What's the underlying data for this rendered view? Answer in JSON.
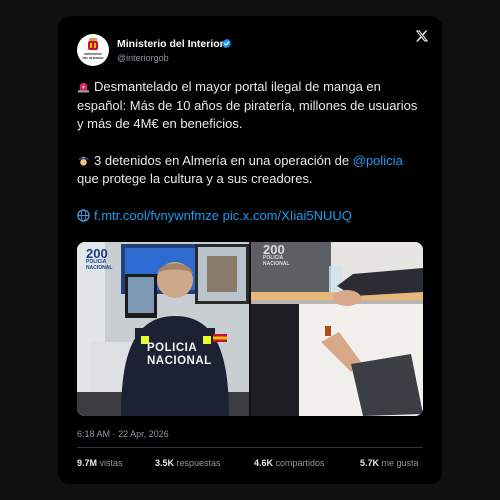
{
  "account": {
    "name": "Ministerio del Interior",
    "handle": "@interiorgob",
    "avatar_text": "MINISTERIO\nDEL INTERIOR",
    "verified_color": "#1d9bf0"
  },
  "tweet": {
    "line1_emoji": "siren-icon",
    "line1": "Desmantelado el mayor portal ilegal de manga en español: Más de 10 años de piratería, millones de usuarios y más de 4M€ en beneficios.",
    "line2_emoji": "police-officer-icon",
    "line2_before": "3 detenidos en Almería en una operación de ",
    "line2_mention": "@policia",
    "line2_after": " que protege la cultura y a sus creadores.",
    "link_emoji": "globe-icon",
    "link1": "f.mtr.cool/fvnywnfmze",
    "link2": "pic.x.com/XIiai5NUUQ"
  },
  "media": {
    "left_logo_number": "200",
    "left_logo_text": "POLICIA\nNACIONAL",
    "left_vest_text": "POLICIA\nNACIONAL",
    "right_logo_number": "200",
    "right_logo_text": "POLICIA\nNACIONAL"
  },
  "meta": {
    "time": "6:18 AM",
    "separator": "·",
    "date": "22 Apr, 2026"
  },
  "stats": [
    {
      "value": "9.7M",
      "label": "vistas"
    },
    {
      "value": "3.5K",
      "label": "respuestas"
    },
    {
      "value": "4.6K",
      "label": "compartidos"
    },
    {
      "value": "5.7K",
      "label": "me gusta"
    }
  ],
  "colors": {
    "link": "#1d9bf0",
    "background": "#000000",
    "text": "#e7e9ea",
    "muted": "#8b98a5"
  }
}
